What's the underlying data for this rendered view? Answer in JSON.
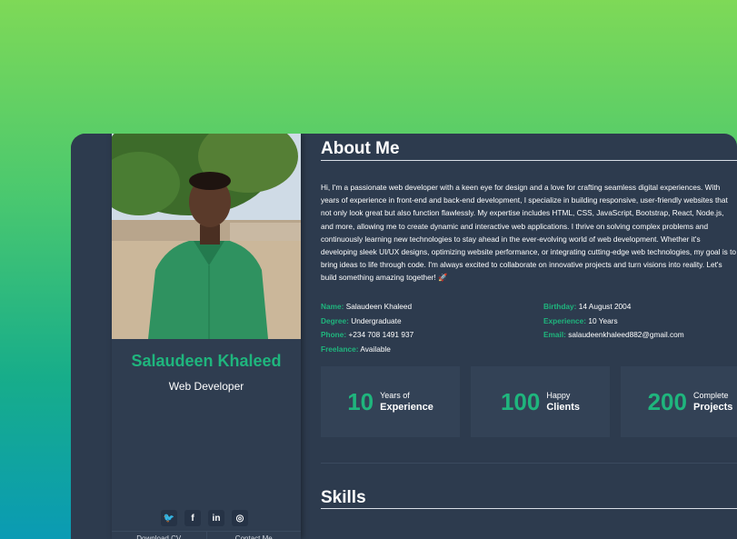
{
  "profile": {
    "name": "Salaudeen Khaleed",
    "role": "Web Developer",
    "photo_alt": "Profile photo"
  },
  "socials": [
    {
      "icon": "twitter-icon",
      "glyph": "🐦"
    },
    {
      "icon": "facebook-icon",
      "glyph": "f"
    },
    {
      "icon": "linkedin-icon",
      "glyph": "in"
    },
    {
      "icon": "instagram-icon",
      "glyph": "◎"
    }
  ],
  "sidebar_buttons": {
    "download_cv": "Download CV",
    "contact_me": "Contact Me"
  },
  "about": {
    "heading": "About Me",
    "lines": [
      "Hi, I'm a passionate web developer with a keen eye for design and a love for crafting seamless digital experiences. With",
      "years of experience in front-end and back-end development, I specialize in building responsive, user-friendly websites that",
      "not only look great but also function flawlessly. My expertise includes HTML, CSS, JavaScript, Bootstrap, React, Node.js,",
      "and more, allowing me to create dynamic and interactive web applications. I thrive on solving complex problems and",
      "continuously learning new technologies to stay ahead in the ever-evolving world of web development. Whether it's",
      "developing sleek UI/UX designs, optimizing website performance, or integrating cutting-edge web technologies, my goal is to",
      "bring ideas to life through code. I'm always excited to collaborate on innovative projects and turn visions into reality. Let's",
      "build something amazing together! 🚀"
    ]
  },
  "info": {
    "left": [
      {
        "label": "Name:",
        "value": "Salaudeen Khaleed"
      },
      {
        "label": "Degree:",
        "value": "Undergraduate"
      },
      {
        "label": "Phone:",
        "value": "+234 708 1491 937"
      },
      {
        "label": "Freelance:",
        "value": "Available"
      }
    ],
    "right": [
      {
        "label": "Birthday:",
        "value": "14 August 2004"
      },
      {
        "label": "Experience:",
        "value": "10 Years"
      },
      {
        "label": "Email:",
        "value": "salaudeenkhaleed882@gmail.com"
      }
    ]
  },
  "stats": [
    {
      "number": "10",
      "line1": "Years of",
      "line2": "Experience"
    },
    {
      "number": "100",
      "line1": "Happy",
      "line2": "Clients"
    },
    {
      "number": "200",
      "line1": "Complete",
      "line2": "Projects"
    }
  ],
  "skills": {
    "heading": "Skills"
  },
  "colors": {
    "accent": "#1fb57d",
    "panel": "#2d3b4e"
  }
}
